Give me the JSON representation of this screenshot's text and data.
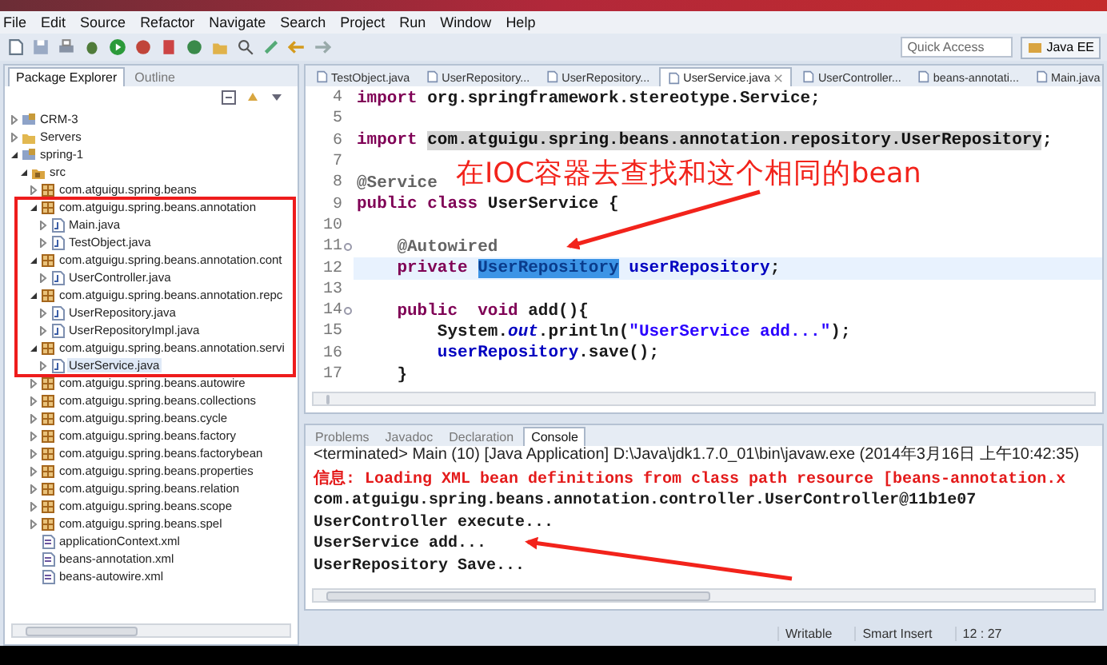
{
  "menu": [
    "File",
    "Edit",
    "Source",
    "Refactor",
    "Navigate",
    "Search",
    "Project",
    "Run",
    "Window",
    "Help"
  ],
  "quick_access": {
    "placeholder": "Quick Access"
  },
  "perspective": "Java EE",
  "left_tabs": [
    {
      "label": "Package Explorer",
      "selected": true
    },
    {
      "label": "Outline",
      "selected": false
    }
  ],
  "tree": [
    {
      "label": "CRM-3",
      "kind": "project",
      "expanded": false,
      "selected": false
    },
    {
      "label": "Servers",
      "kind": "folder",
      "expanded": false,
      "selected": false
    },
    {
      "label": "spring-1",
      "kind": "project",
      "expanded": true,
      "selected": false,
      "children": [
        {
          "label": "src",
          "kind": "source",
          "expanded": true,
          "selected": false,
          "children": [
            {
              "label": "com.atguigu.spring.beans",
              "kind": "package",
              "expanded": false,
              "selected": false
            },
            {
              "label": "com.atguigu.spring.beans.annotation",
              "kind": "package",
              "expanded": true,
              "selected": false,
              "children": [
                {
                  "label": "Main.java",
                  "kind": "java",
                  "expanded": false,
                  "selected": false
                },
                {
                  "label": "TestObject.java",
                  "kind": "java",
                  "expanded": false,
                  "selected": false
                }
              ]
            },
            {
              "label": "com.atguigu.spring.beans.annotation.cont",
              "kind": "package",
              "expanded": true,
              "selected": false,
              "children": [
                {
                  "label": "UserController.java",
                  "kind": "java",
                  "expanded": false,
                  "selected": false
                }
              ]
            },
            {
              "label": "com.atguigu.spring.beans.annotation.repc",
              "kind": "package",
              "expanded": true,
              "selected": false,
              "children": [
                {
                  "label": "UserRepository.java",
                  "kind": "java",
                  "expanded": false,
                  "selected": false
                },
                {
                  "label": "UserRepositoryImpl.java",
                  "kind": "java",
                  "expanded": false,
                  "selected": false
                }
              ]
            },
            {
              "label": "com.atguigu.spring.beans.annotation.servi",
              "kind": "package",
              "expanded": true,
              "selected": false,
              "children": [
                {
                  "label": "UserService.java",
                  "kind": "java",
                  "expanded": false,
                  "selected": true
                }
              ]
            },
            {
              "label": "com.atguigu.spring.beans.autowire",
              "kind": "package",
              "expanded": false,
              "selected": false
            },
            {
              "label": "com.atguigu.spring.beans.collections",
              "kind": "package",
              "expanded": false,
              "selected": false
            },
            {
              "label": "com.atguigu.spring.beans.cycle",
              "kind": "package",
              "expanded": false,
              "selected": false
            },
            {
              "label": "com.atguigu.spring.beans.factory",
              "kind": "package",
              "expanded": false,
              "selected": false
            },
            {
              "label": "com.atguigu.spring.beans.factorybean",
              "kind": "package",
              "expanded": false,
              "selected": false
            },
            {
              "label": "com.atguigu.spring.beans.properties",
              "kind": "package",
              "expanded": false,
              "selected": false
            },
            {
              "label": "com.atguigu.spring.beans.relation",
              "kind": "package",
              "expanded": false,
              "selected": false
            },
            {
              "label": "com.atguigu.spring.beans.scope",
              "kind": "package",
              "expanded": false,
              "selected": false
            },
            {
              "label": "com.atguigu.spring.beans.spel",
              "kind": "package",
              "expanded": false,
              "selected": false
            },
            {
              "label": "applicationContext.xml",
              "kind": "xml",
              "selected": false
            },
            {
              "label": "beans-annotation.xml",
              "kind": "xml",
              "selected": false
            },
            {
              "label": "beans-autowire.xml",
              "kind": "xml",
              "selected": false
            }
          ]
        }
      ]
    }
  ],
  "editor_tabs": [
    {
      "label": "TestObject.java",
      "selected": false
    },
    {
      "label": "UserRepository...",
      "selected": false
    },
    {
      "label": "UserRepository...",
      "selected": false
    },
    {
      "label": "UserService.java",
      "selected": true
    },
    {
      "label": "UserController...",
      "selected": false
    },
    {
      "label": "beans-annotati...",
      "selected": false
    },
    {
      "label": "Main.java",
      "selected": false
    }
  ],
  "code": [
    {
      "number": "4",
      "fold": false,
      "current": false,
      "segments": [
        {
          "kind": "kw",
          "text": "import"
        },
        {
          "kind": "plain",
          "text": " org.springframework.stereotype.Service;"
        }
      ]
    },
    {
      "number": "5",
      "fold": false,
      "current": false
    },
    {
      "number": "6",
      "fold": false,
      "current": false,
      "segments": [
        {
          "kind": "kw",
          "text": "import "
        },
        {
          "kind": "hl",
          "text": "com.atguigu.spring.beans.annotation.repository.UserRepository"
        },
        {
          "kind": "plain",
          "text": ";"
        }
      ]
    },
    {
      "number": "7",
      "fold": false,
      "current": false
    },
    {
      "number": "8",
      "fold": false,
      "current": false,
      "segments": [
        {
          "kind": "ann",
          "text": "@Service"
        }
      ]
    },
    {
      "number": "9",
      "fold": false,
      "current": false,
      "segments": [
        {
          "kind": "kw",
          "text": "public class"
        },
        {
          "kind": "plain",
          "text": " UserService {"
        }
      ]
    },
    {
      "number": "10",
      "fold": false,
      "current": false
    },
    {
      "number": "11",
      "fold": true,
      "current": false,
      "segments": [
        {
          "kind": "ann",
          "text": "    @Autowired"
        }
      ]
    },
    {
      "number": "12",
      "fold": false,
      "current": true,
      "segments": [
        {
          "kind": "kw",
          "text": "    private "
        },
        {
          "kind": "sel",
          "text": "UserRepository"
        },
        {
          "kind": "field",
          "text": " userRepository"
        },
        {
          "kind": "plain",
          "text": ";"
        }
      ]
    },
    {
      "number": "13",
      "fold": false,
      "current": false
    },
    {
      "number": "14",
      "fold": true,
      "current": false,
      "segments": [
        {
          "kind": "kw",
          "text": "    public  void"
        },
        {
          "kind": "plain",
          "text": " add(){"
        }
      ]
    },
    {
      "number": "15",
      "fold": false,
      "current": false,
      "segments": [
        {
          "kind": "plain",
          "text": "        System."
        },
        {
          "kind": "static",
          "text": "out"
        },
        {
          "kind": "plain",
          "text": ".println("
        },
        {
          "kind": "str",
          "text": "\"UserService add...\""
        },
        {
          "kind": "plain",
          "text": ");"
        }
      ]
    },
    {
      "number": "16",
      "fold": false,
      "current": false,
      "segments": [
        {
          "kind": "field",
          "text": "        userRepository"
        },
        {
          "kind": "plain",
          "text": ".save();"
        }
      ]
    },
    {
      "number": "17",
      "fold": false,
      "current": false,
      "segments": [
        {
          "kind": "plain",
          "text": "    }"
        }
      ]
    }
  ],
  "console_tabs": [
    {
      "label": "Problems",
      "selected": false
    },
    {
      "label": "Javadoc",
      "selected": false
    },
    {
      "label": "Declaration",
      "selected": false
    },
    {
      "label": "Console",
      "selected": true
    }
  ],
  "console_header": "<terminated> Main (10) [Java Application] D:\\Java\\jdk1.7.0_01\\bin\\javaw.exe (2014年3月16日 上午10:42:35)",
  "console_lines": [
    {
      "kind": "error",
      "text": "信息: Loading XML bean definitions from class path resource [beans-annotation.x"
    },
    {
      "kind": "out",
      "text": "com.atguigu.spring.beans.annotation.controller.UserController@11b1e07"
    },
    {
      "kind": "out",
      "text": "UserController execute..."
    },
    {
      "kind": "out",
      "text": "UserService add..."
    },
    {
      "kind": "out",
      "text": "UserRepository Save..."
    }
  ],
  "status_bar": [
    "Writable",
    "Smart Insert",
    "12 : 27"
  ],
  "annotation": {
    "note": "在IOC容器去查找和这个相同的bean"
  }
}
